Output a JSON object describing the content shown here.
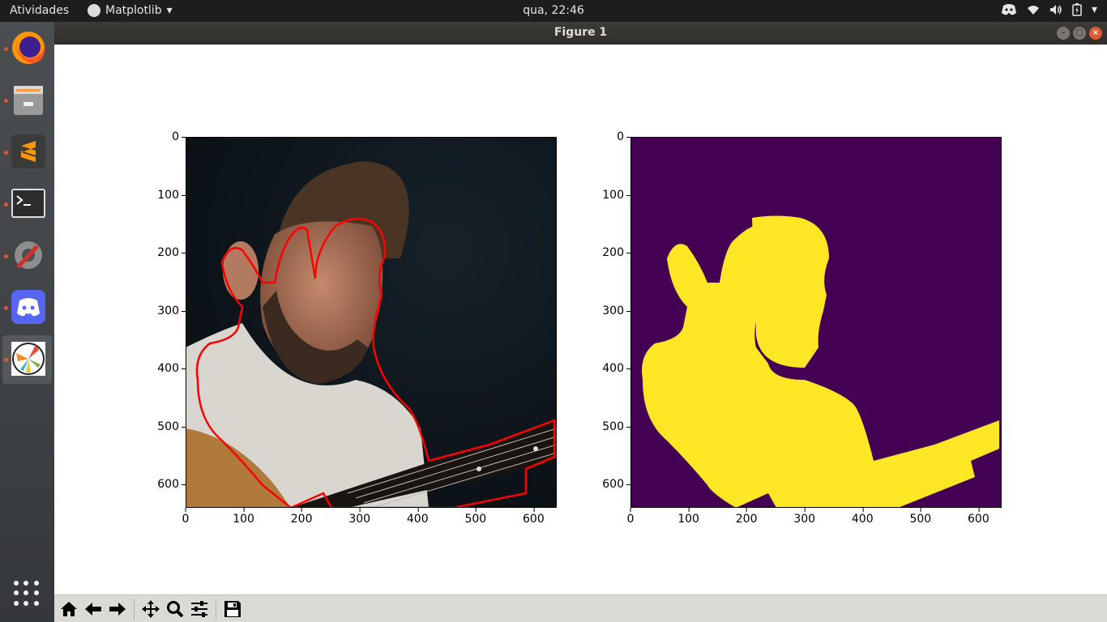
{
  "topbar": {
    "activities": "Atividades",
    "app_name": "Matplotlib",
    "clock": "qua, 22:46",
    "tray_icons": [
      "discord-icon",
      "wifi-icon",
      "volume-icon",
      "battery-icon",
      "system-menu-arrow-icon"
    ]
  },
  "window": {
    "title": "Figure 1",
    "buttons": [
      "minimize",
      "maximize",
      "close"
    ]
  },
  "dock": {
    "items": [
      "firefox",
      "files",
      "sublime-text",
      "terminal",
      "software-settings",
      "discord",
      "matplotlib-figure"
    ],
    "active_item": "matplotlib-figure",
    "show_apps": "apps-grid-icon"
  },
  "figure": {
    "left_axes": {
      "content": "photo with red segmentation contour",
      "contour_color": "#ff0000",
      "x_ticks": [
        "0",
        "100",
        "200",
        "300",
        "400",
        "500",
        "600"
      ],
      "y_ticks": [
        "0",
        "100",
        "200",
        "300",
        "400",
        "500",
        "600"
      ]
    },
    "right_axes": {
      "content": "binary mask (viridis)",
      "background_color": "#440154",
      "mask_color": "#fde725",
      "x_ticks": [
        "0",
        "100",
        "200",
        "300",
        "400",
        "500",
        "600"
      ],
      "y_ticks": [
        "0",
        "100",
        "200",
        "300",
        "400",
        "500",
        "600"
      ]
    },
    "image_extent": [
      640,
      640
    ]
  },
  "toolbar": {
    "buttons": [
      "home-icon",
      "back-icon",
      "forward-icon",
      "pan-icon",
      "zoom-icon",
      "configure-subplots-icon",
      "save-icon"
    ]
  }
}
